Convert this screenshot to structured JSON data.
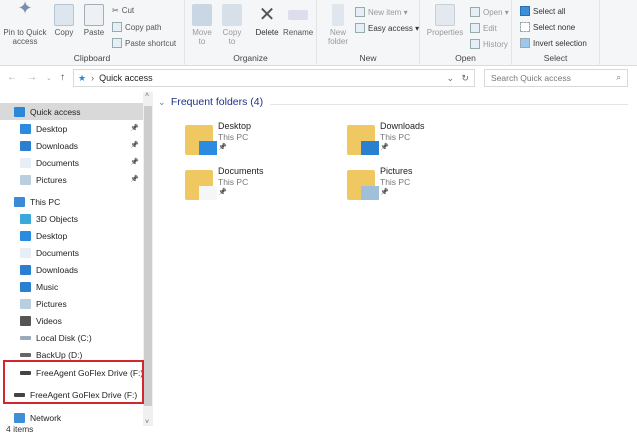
{
  "ribbon": {
    "clipboard": {
      "label": "Clipboard",
      "pin": "Pin to Quick access",
      "copy": "Copy",
      "paste": "Paste",
      "cut": "Cut",
      "copy_path": "Copy path",
      "paste_shortcut": "Paste shortcut"
    },
    "organize": {
      "label": "Organize",
      "move_to": "Move to",
      "copy_to": "Copy to",
      "delete": "Delete",
      "rename": "Rename"
    },
    "new": {
      "label": "New",
      "new_folder": "New folder",
      "new_item": "New item ▾",
      "easy_access": "Easy access ▾"
    },
    "open": {
      "label": "Open",
      "properties": "Properties",
      "open": "Open ▾",
      "edit": "Edit",
      "history": "History"
    },
    "select": {
      "label": "Select",
      "select_all": "Select all",
      "select_none": "Select none",
      "invert": "Invert selection"
    }
  },
  "address": {
    "path": "Quick access",
    "search_placeholder": "Search Quick access"
  },
  "nav": {
    "quick_access": "Quick access",
    "quick_items": [
      "Desktop",
      "Downloads",
      "Documents",
      "Pictures"
    ],
    "this_pc": "This PC",
    "pc_items": [
      "3D Objects",
      "Desktop",
      "Documents",
      "Downloads",
      "Music",
      "Pictures",
      "Videos",
      "Local Disk (C:)",
      "BackUp (D:)"
    ],
    "drive_f1": "FreeAgent GoFlex Drive (F:)",
    "drive_f2": "FreeAgent GoFlex Drive (F:)",
    "network": "Network"
  },
  "main": {
    "section_title": "Frequent folders (4)",
    "folders": [
      {
        "name": "Desktop",
        "location": "This PC"
      },
      {
        "name": "Downloads",
        "location": "This PC"
      },
      {
        "name": "Documents",
        "location": "This PC"
      },
      {
        "name": "Pictures",
        "location": "This PC"
      }
    ]
  },
  "status": {
    "items": "4 items"
  },
  "colors": {
    "highlight": "#d0282e",
    "accent": "#1e88e5"
  }
}
